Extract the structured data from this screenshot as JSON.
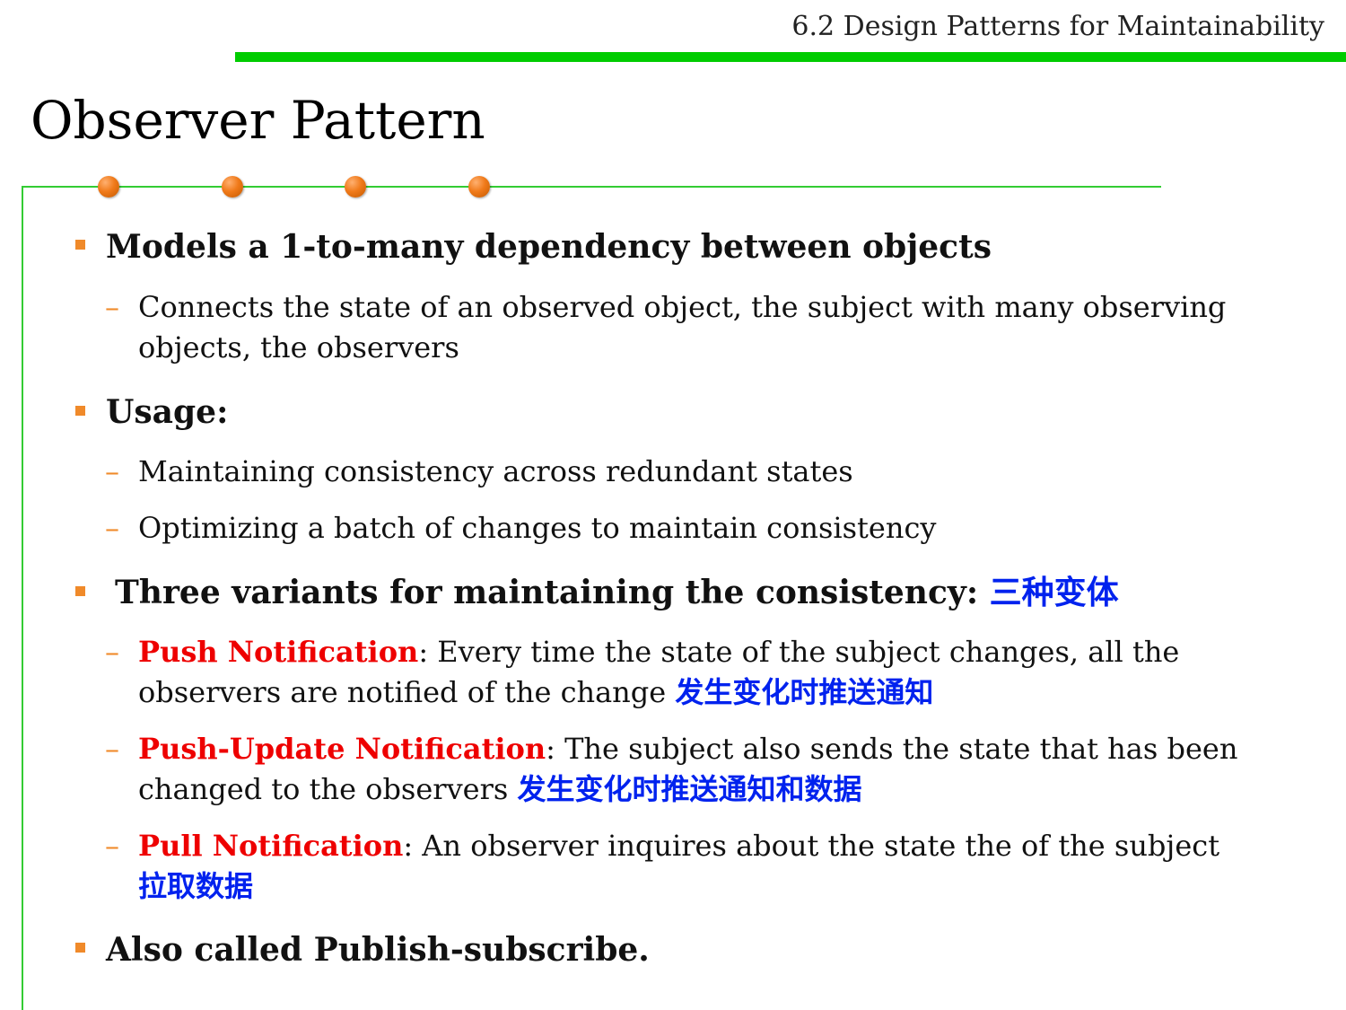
{
  "header": {
    "section_title": "6.2 Design Patterns for Maintainability"
  },
  "slide": {
    "title": "Observer Pattern"
  },
  "bullets": [
    {
      "text": "Models a 1-to-many dependency between objects",
      "subs": [
        {
          "line1": "Connects the state of an observed object, the subject with many observing",
          "line2": "objects, the observers"
        }
      ]
    },
    {
      "text": "Usage:",
      "subs": [
        {
          "text": "Maintaining consistency across redundant states"
        },
        {
          "text": "Optimizing a batch of changes to maintain consistency"
        }
      ]
    },
    {
      "text": "Three variants for maintaining the consistency:",
      "cn": "三种变体",
      "subs": [
        {
          "term": "Push Notification",
          "rest": ": Every time the state of the subject changes, all the",
          "line2": "observers are notified of the change ",
          "cn": "发生变化时推送通知"
        },
        {
          "term": "Push-Update Notification",
          "rest": ": The subject also sends the state that has been",
          "line2": "changed to the observers ",
          "cn": "发生变化时推送通知和数据"
        },
        {
          "term": "Pull Notification",
          "rest": ":  An observer inquires about the state the of the subject",
          "cn": "拉取数据"
        }
      ]
    },
    {
      "text": "Also called Publish-subscribe."
    }
  ],
  "colors": {
    "accent_green": "#00cc00",
    "bullet_orange": "#f08a2a",
    "term_red": "#ee0000",
    "chinese_blue": "#0022ee"
  }
}
